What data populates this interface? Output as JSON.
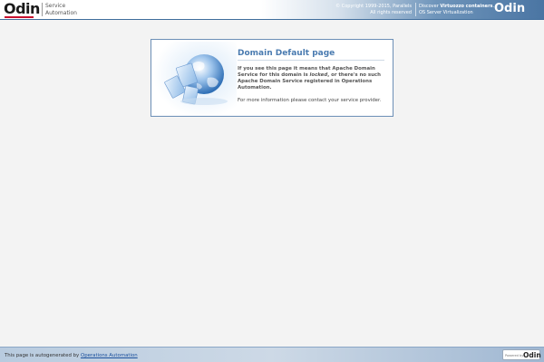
{
  "header": {
    "logo": "Odin",
    "product_line1": "Service",
    "product_line2": "Automation",
    "copyright_line1": "© Copyright 1999-2015, Parallels",
    "copyright_line2": "All rights reserved",
    "discover_prefix": "Discover ",
    "discover_bold": "Virtuozzo containers",
    "discover_suffix": ".",
    "discover_line2": "OS Server Virtualization",
    "logo_right": "Odin"
  },
  "main": {
    "title": "Domain Default page",
    "text_part1": "If you see this page it means that Apache Domain Service for this domain is ",
    "text_locked": "locked",
    "text_part2": ", or there's no such Apache Domain Service registered in Operations Automation.",
    "contact": "For more information please contact your service provider.",
    "illustration_icon": "globe-icon"
  },
  "footer": {
    "text_prefix": "This page is autogenerated by ",
    "link_text": "Operations Automation",
    "powered_label": "Powered by",
    "powered_logo": "Odin"
  },
  "colors": {
    "accent": "#4a7bb0",
    "brand_red": "#c8102e",
    "header_blue": "#4a75a3",
    "box_border": "#6c8fb6"
  }
}
